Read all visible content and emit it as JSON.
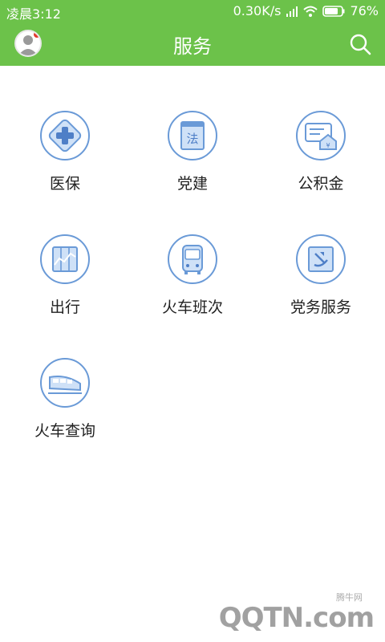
{
  "statusbar": {
    "time": "凌晨3:12",
    "net_speed": "0.30K/s",
    "battery": "76%"
  },
  "appbar": {
    "title": "服务"
  },
  "colors": {
    "appbar": "#6cc24a",
    "icon_stroke": "#6a9ad7",
    "icon_fill": "#cfe1f7"
  },
  "grid": {
    "items": [
      {
        "label": "医保",
        "icon": "medical-cross-icon"
      },
      {
        "label": "党建",
        "icon": "law-book-icon"
      },
      {
        "label": "公积金",
        "icon": "housing-fund-icon"
      },
      {
        "label": "出行",
        "icon": "travel-chart-icon"
      },
      {
        "label": "火车班次",
        "icon": "bus-icon"
      },
      {
        "label": "党务服务",
        "icon": "party-emblem-icon"
      },
      {
        "label": "火车查询",
        "icon": "train-icon"
      }
    ]
  },
  "watermark": {
    "site": "腾牛网",
    "logo": "QQTN.com"
  }
}
